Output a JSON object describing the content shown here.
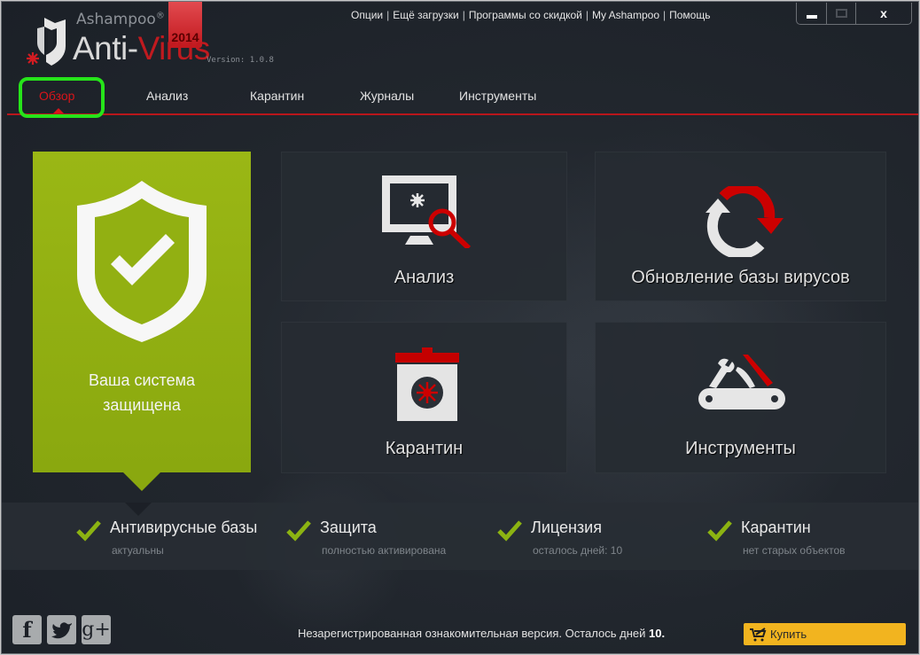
{
  "app": {
    "brand": "Ashampoo",
    "product_main": "Anti-",
    "product_accent": "Virus",
    "year": "2014",
    "version": "Version: 1.0.8",
    "registered_mark": "®"
  },
  "top_links": [
    {
      "label": "Опции"
    },
    {
      "label": "Ещё загрузки"
    },
    {
      "label": "Программы со скидкой"
    },
    {
      "label": "My Ashampoo"
    },
    {
      "label": "Помощь"
    }
  ],
  "top_links_separator": "|",
  "window_controls": {
    "minimize": "minimize",
    "maximize": "maximize",
    "close": "x"
  },
  "nav": {
    "items": [
      {
        "label": "Обзор",
        "active": true
      },
      {
        "label": "Анализ",
        "active": false
      },
      {
        "label": "Карантин",
        "active": false
      },
      {
        "label": "Журналы",
        "active": false
      },
      {
        "label": "Инструменты",
        "active": false
      }
    ]
  },
  "status_tile": {
    "icon": "shield-check-icon",
    "line1": "Ваша система",
    "line2": "защищена",
    "color": "#9ab715"
  },
  "tiles": [
    {
      "label": "Анализ",
      "icon": "monitor-scan-icon"
    },
    {
      "label": "Обновление базы вирусов",
      "icon": "refresh-icon"
    },
    {
      "label": "Карантин",
      "icon": "quarantine-box-icon"
    },
    {
      "label": "Инструменты",
      "icon": "swiss-knife-icon"
    }
  ],
  "status_items": [
    {
      "title": "Антивирусные базы",
      "sub": "актуальны",
      "ok": true
    },
    {
      "title": "Защита",
      "sub": "полностью активирована",
      "ok": true
    },
    {
      "title": "Лицензия",
      "sub": "осталось дней: 10",
      "ok": true
    },
    {
      "title": "Карантин",
      "sub": "нет старых объектов",
      "ok": true
    }
  ],
  "social": [
    {
      "glyph": "f",
      "icon": "facebook-icon"
    },
    {
      "glyph": "t",
      "icon": "twitter-icon"
    },
    {
      "glyph": "g+",
      "icon": "google-plus-icon"
    }
  ],
  "footer": {
    "trial_text": "Незарегистрированная ознакомительная версия. Осталось дней ",
    "days_left": "10.",
    "buy_label": "Купить"
  },
  "colors": {
    "accent_red": "#c01a1f",
    "status_green": "#9ab715",
    "buy_yellow": "#f2b41f",
    "highlight_green": "#26e41a"
  }
}
